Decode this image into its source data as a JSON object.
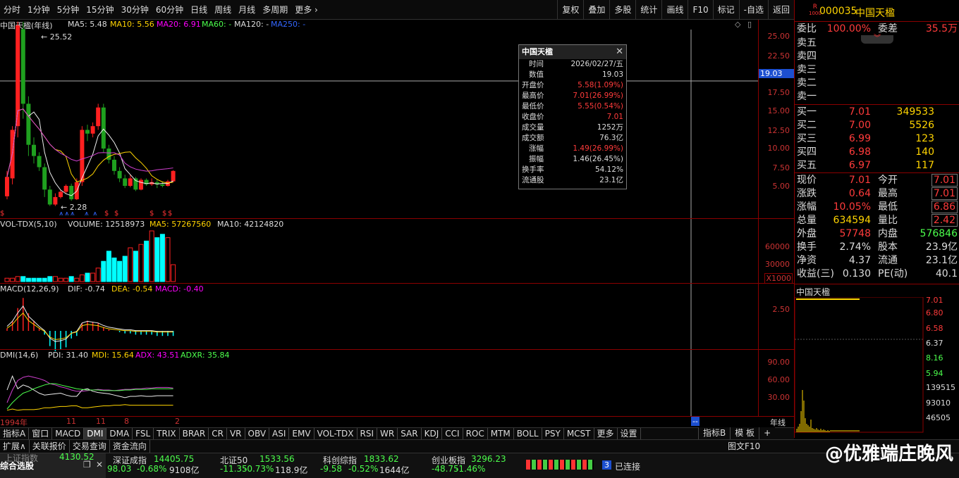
{
  "toolbar": {
    "periods": [
      "分时",
      "1分钟",
      "5分钟",
      "15分钟",
      "30分钟",
      "60分钟",
      "日线",
      "周线",
      "月线",
      "多周期"
    ],
    "more": "更多",
    "right_buttons": [
      "复权",
      "叠加",
      "多股",
      "统计",
      "画线",
      "F10",
      "标记",
      "-自选",
      "返回"
    ]
  },
  "main_chart": {
    "title": "中国天楹(年线)",
    "ma5": "MA5: 5.48",
    "ma10": "MA10: 5.56",
    "ma20": "MA20: 6.91",
    "ma60": "MA60: -",
    "ma120": "MA120: -",
    "ma250": "MA250: -",
    "high_label": "25.52",
    "low_label": "2.28",
    "y_ticks": [
      "25.00",
      "22.50",
      "17.50",
      "15.00",
      "12.50",
      "10.00",
      "7.50",
      "5.00"
    ],
    "cursor_value": "19.03",
    "candles": [
      [
        3.6,
        6.2,
        3.2,
        7.0
      ],
      [
        6.0,
        12.5,
        5.2,
        13.0
      ],
      [
        13.0,
        26.5,
        11.5,
        27.0
      ],
      [
        26.0,
        16.0,
        14.0,
        27.0
      ],
      [
        16.0,
        10.5,
        9.0,
        17.0
      ],
      [
        10.5,
        9.0,
        8.0,
        11.5
      ],
      [
        9.0,
        7.5,
        7.0,
        9.5
      ],
      [
        7.5,
        4.5,
        3.5,
        8.0
      ],
      [
        4.5,
        2.5,
        2.3,
        5.0
      ],
      [
        2.5,
        3.5,
        2.3,
        4.0
      ],
      [
        3.5,
        4.2,
        3.3,
        4.5
      ],
      [
        4.2,
        5.0,
        4.0,
        5.2
      ],
      [
        5.0,
        3.2,
        3.0,
        5.3
      ],
      [
        3.2,
        5.5,
        3.1,
        6.0
      ],
      [
        5.5,
        12.5,
        5.0,
        13.0
      ],
      [
        12.5,
        12.0,
        11.0,
        13.2
      ],
      [
        12.0,
        13.0,
        11.5,
        13.5
      ],
      [
        13.0,
        15.5,
        12.5,
        16.0
      ],
      [
        15.5,
        10.0,
        9.5,
        16.0
      ],
      [
        10.0,
        8.5,
        8.0,
        10.5
      ],
      [
        8.5,
        7.0,
        6.5,
        9.0
      ],
      [
        7.0,
        6.0,
        5.5,
        7.5
      ],
      [
        6.0,
        5.0,
        4.7,
        6.5
      ],
      [
        5.0,
        6.0,
        4.8,
        6.5
      ],
      [
        6.0,
        4.5,
        4.3,
        6.2
      ],
      [
        4.5,
        5.8,
        4.4,
        6.0
      ],
      [
        5.8,
        5.2,
        5.0,
        6.0
      ],
      [
        5.2,
        5.5,
        5.0,
        6.0
      ],
      [
        5.5,
        5.2,
        4.7,
        5.8
      ],
      [
        5.2,
        5.0,
        4.8,
        5.6
      ],
      [
        5.0,
        5.6,
        4.9,
        5.8
      ],
      [
        5.6,
        7.0,
        5.5,
        7.1
      ]
    ]
  },
  "vol_panel": {
    "title": "VOL-TDX(5,10)",
    "volume": "VOLUME: 12518973",
    "ma5": "MA5: 57267560",
    "ma10": "MA10: 42124820",
    "ticks": [
      "60000",
      "30000"
    ],
    "unit": "X1000",
    "vols": [
      2,
      2,
      3,
      3,
      2,
      2,
      2,
      2,
      3,
      3,
      2,
      2,
      3,
      2,
      4,
      5,
      5,
      8,
      12,
      18,
      14,
      12,
      15,
      20,
      18,
      22,
      24,
      30,
      26,
      28,
      26,
      10
    ]
  },
  "macd_panel": {
    "title": "MACD(12,26,9)",
    "dif": "DIF: -0.74",
    "dea": "DEA: -0.54",
    "macd": "MACD: -0.40",
    "tick": "2.50",
    "bars": [
      0.2,
      0.8,
      1.8,
      2.6,
      1.4,
      0.8,
      0.2,
      -0.3,
      -1.2,
      -1.6,
      -1.5,
      -1.3,
      -0.6,
      -0.4,
      0.6,
      0.8,
      0.7,
      0.6,
      0.3,
      0.1,
      0.0,
      -0.1,
      -0.2,
      -0.2,
      -0.3,
      -0.3,
      -0.3,
      -0.3,
      -0.4,
      -0.4,
      -0.4,
      -0.4
    ]
  },
  "dmi_panel": {
    "title": "DMI(14,6)",
    "pdi": "PDI: 31.40",
    "mdi": "MDI: 15.64",
    "adx": "ADX: 43.51",
    "adxr": "ADXR: 35.84",
    "ticks": [
      "90.00",
      "60.00",
      "30.00"
    ]
  },
  "x_axis": {
    "labels": [
      "1994年",
      "11",
      "11",
      "8",
      "2"
    ],
    "unit": "年线"
  },
  "tooltip": {
    "title": "中国天楹",
    "rows": [
      [
        "时间",
        "2026/02/27/五"
      ],
      [
        "数值",
        "19.03"
      ],
      [
        "开盘价",
        "5.58(1.09%)"
      ],
      [
        "最高价",
        "7.01(26.99%)"
      ],
      [
        "最低价",
        "5.55(0.54%)"
      ],
      [
        "收盘价",
        "7.01"
      ],
      [
        "成交量",
        "1252万"
      ],
      [
        "成交额",
        "76.3亿"
      ],
      [
        "涨幅",
        "1.49(26.99%)"
      ],
      [
        "振幅",
        "1.46(26.45%)"
      ],
      [
        "换手率",
        "54.12%"
      ],
      [
        "流通股",
        "23.1亿"
      ]
    ]
  },
  "quote": {
    "badge_r": "R",
    "badge_num": "1000",
    "code": "000035",
    "name": "中国天楹",
    "weibi_label": "委比",
    "weibi": "100.00%",
    "weicha_label": "委差",
    "weicha": "35.5万",
    "sells": [
      "卖五",
      "卖四",
      "卖三",
      "卖二",
      "卖一"
    ],
    "buys": [
      [
        "买一",
        "7.01",
        "349533"
      ],
      [
        "买二",
        "7.00",
        "5526"
      ],
      [
        "买三",
        "6.99",
        "123"
      ],
      [
        "买四",
        "6.98",
        "140"
      ],
      [
        "买五",
        "6.97",
        "117"
      ]
    ],
    "stats": [
      [
        "现价",
        "7.01",
        "今开",
        "7.01"
      ],
      [
        "涨跌",
        "0.64",
        "最高",
        "7.01"
      ],
      [
        "涨幅",
        "10.05%",
        "最低",
        "6.86"
      ],
      [
        "总量",
        "634594",
        "量比",
        "2.42"
      ],
      [
        "外盘",
        "57748",
        "内盘",
        "576846"
      ],
      [
        "换手",
        "2.74%",
        "股本",
        "23.9亿"
      ],
      [
        "净资",
        "4.37",
        "流通",
        "23.1亿"
      ],
      [
        "收益(三)",
        "0.130",
        "PE(动)",
        "40.1"
      ]
    ],
    "mini_title": "中国天楹",
    "mini_ticks": [
      "7.01",
      "6.80",
      "6.58",
      "6.37",
      "8.16",
      "5.94",
      "139515",
      "93010",
      "46505"
    ]
  },
  "tabs": [
    "指标A",
    "窗口",
    "MACD",
    "DMI",
    "DMA",
    "FSL",
    "TRIX",
    "BRAR",
    "CR",
    "VR",
    "OBV",
    "ASI",
    "EMV",
    "VOL-TDX",
    "RSI",
    "WR",
    "SAR",
    "KDJ",
    "CCI",
    "ROC",
    "MTM",
    "BOLL",
    "PSY",
    "MCST",
    "更多",
    "设置"
  ],
  "tabs_right": [
    "指标B",
    "模 板",
    "+"
  ],
  "subbar": [
    "扩展∧",
    "关联报价",
    "交易查询",
    "资金流向"
  ],
  "status": {
    "left_title": "综合选股",
    "sh_label": "上证指数",
    "sh_val": "4130.52",
    "sh_chg": "98.03",
    "sh_pct": "-0.68%",
    "sh_amt": "9108亿",
    "sz_label": "深证成指",
    "sz_val": "14405.75",
    "sz_chg": "-11.35",
    "sz_pct": "-0.73%",
    "sz_amt": "118.9亿",
    "bz_label": "北证50",
    "bz_val": "1533.56",
    "kc_label": "科创综指",
    "kc_val": "1833.62",
    "kc_chg": "-9.58",
    "kc_pct": "-0.52%",
    "kc_amt": "1644亿",
    "cy_label": "创业板指",
    "cy_val": "3296.23",
    "cy_chg": "-48.75",
    "cy_pct": "-1.46%",
    "conn_num": "3",
    "conn": "已连接",
    "extra": "图文F10"
  },
  "watermark": "@优雅端庄晚风"
}
